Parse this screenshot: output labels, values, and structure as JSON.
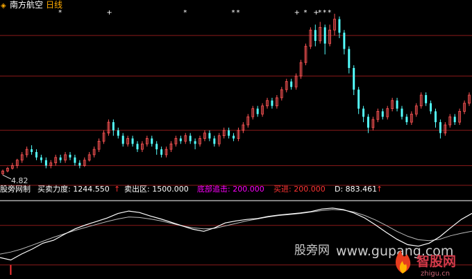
{
  "header": {
    "stock_icon": "diamond-icon",
    "stock_name": "南方航空",
    "period": "日线"
  },
  "chart_data": [
    {
      "type": "candlestick",
      "title": "南方航空 日线",
      "low_label": "4.82",
      "signal_marker": "*",
      "signal_text": "+",
      "ylim": [
        4.6,
        11.0
      ],
      "gridlines": [
        10.0,
        8.5,
        6.5,
        5.2
      ],
      "candles": [
        [
          4.9,
          5.0,
          4.85,
          5.05
        ],
        [
          5.0,
          5.1,
          4.95,
          5.15
        ],
        [
          5.1,
          5.2,
          5.05,
          5.3
        ],
        [
          5.2,
          5.4,
          5.1,
          5.45
        ],
        [
          5.4,
          5.6,
          5.3,
          5.7
        ],
        [
          5.6,
          5.8,
          5.5,
          5.9
        ],
        [
          5.8,
          5.7,
          5.6,
          5.95
        ],
        [
          5.7,
          5.5,
          5.4,
          5.8
        ],
        [
          5.5,
          5.4,
          5.3,
          5.6
        ],
        [
          5.4,
          5.2,
          5.1,
          5.5
        ],
        [
          5.2,
          5.3,
          5.1,
          5.4
        ],
        [
          5.3,
          5.5,
          5.2,
          5.6
        ],
        [
          5.5,
          5.4,
          5.3,
          5.6
        ],
        [
          5.4,
          5.6,
          5.3,
          5.7
        ],
        [
          5.6,
          5.5,
          5.4,
          5.7
        ],
        [
          5.5,
          5.3,
          5.2,
          5.6
        ],
        [
          5.3,
          5.2,
          5.1,
          5.4
        ],
        [
          5.2,
          5.4,
          5.15,
          5.5
        ],
        [
          5.4,
          5.6,
          5.35,
          5.7
        ],
        [
          5.6,
          5.8,
          5.5,
          5.9
        ],
        [
          5.8,
          6.1,
          5.7,
          6.2
        ],
        [
          6.1,
          6.4,
          6.0,
          6.5
        ],
        [
          6.4,
          6.8,
          6.3,
          6.9
        ],
        [
          6.8,
          6.5,
          6.3,
          6.9
        ],
        [
          6.5,
          6.3,
          6.2,
          6.6
        ],
        [
          6.3,
          6.0,
          5.9,
          6.4
        ],
        [
          6.0,
          6.2,
          5.9,
          6.3
        ],
        [
          6.2,
          6.0,
          5.9,
          6.3
        ],
        [
          6.0,
          5.8,
          5.7,
          6.1
        ],
        [
          5.8,
          6.0,
          5.7,
          6.1
        ],
        [
          6.0,
          6.2,
          5.9,
          6.3
        ],
        [
          6.2,
          6.0,
          5.9,
          6.3
        ],
        [
          6.0,
          5.8,
          5.6,
          6.1
        ],
        [
          5.8,
          5.6,
          5.5,
          5.9
        ],
        [
          5.6,
          5.8,
          5.5,
          5.9
        ],
        [
          5.8,
          6.0,
          5.7,
          6.1
        ],
        [
          6.0,
          6.2,
          5.9,
          6.3
        ],
        [
          6.2,
          6.1,
          6.0,
          6.3
        ],
        [
          6.1,
          6.3,
          6.0,
          6.4
        ],
        [
          6.3,
          6.1,
          6.0,
          6.4
        ],
        [
          6.1,
          6.0,
          5.8,
          6.2
        ],
        [
          6.0,
          6.2,
          5.9,
          6.3
        ],
        [
          6.2,
          6.4,
          6.1,
          6.5
        ],
        [
          6.4,
          6.2,
          6.1,
          6.5
        ],
        [
          6.2,
          6.0,
          5.9,
          6.3
        ],
        [
          6.0,
          6.3,
          5.9,
          6.4
        ],
        [
          6.3,
          6.5,
          6.2,
          6.6
        ],
        [
          6.5,
          6.3,
          6.2,
          6.6
        ],
        [
          6.3,
          6.2,
          6.1,
          6.4
        ],
        [
          6.2,
          6.5,
          6.1,
          6.6
        ],
        [
          6.5,
          6.7,
          6.4,
          6.8
        ],
        [
          6.7,
          7.0,
          6.6,
          7.1
        ],
        [
          7.0,
          7.3,
          6.9,
          7.4
        ],
        [
          7.3,
          7.1,
          7.0,
          7.4
        ],
        [
          7.1,
          7.4,
          7.0,
          7.5
        ],
        [
          7.4,
          7.6,
          7.3,
          7.7
        ],
        [
          7.6,
          7.4,
          7.3,
          7.7
        ],
        [
          7.4,
          7.7,
          7.3,
          7.8
        ],
        [
          7.7,
          8.0,
          7.6,
          8.1
        ],
        [
          8.0,
          8.3,
          7.9,
          8.4
        ],
        [
          8.3,
          8.1,
          8.0,
          8.4
        ],
        [
          8.1,
          8.5,
          8.0,
          8.6
        ],
        [
          8.5,
          9.0,
          8.4,
          9.1
        ],
        [
          9.0,
          9.6,
          8.9,
          9.7
        ],
        [
          9.6,
          10.2,
          9.5,
          10.3
        ],
        [
          10.2,
          9.8,
          9.6,
          10.4
        ],
        [
          9.8,
          10.3,
          9.7,
          10.5
        ],
        [
          10.3,
          9.7,
          9.3,
          10.4
        ],
        [
          9.7,
          10.2,
          9.6,
          10.4
        ],
        [
          10.2,
          10.6,
          10.0,
          10.8
        ],
        [
          10.6,
          10.1,
          9.9,
          10.7
        ],
        [
          10.1,
          9.5,
          9.3,
          10.2
        ],
        [
          9.5,
          8.8,
          8.6,
          9.6
        ],
        [
          8.8,
          8.0,
          7.8,
          8.9
        ],
        [
          8.0,
          7.3,
          7.1,
          8.1
        ],
        [
          7.3,
          7.0,
          6.8,
          7.4
        ],
        [
          7.0,
          6.6,
          6.4,
          7.1
        ],
        [
          6.6,
          6.9,
          6.5,
          7.0
        ],
        [
          6.9,
          7.2,
          6.8,
          7.3
        ],
        [
          7.2,
          7.0,
          6.9,
          7.3
        ],
        [
          7.0,
          7.3,
          6.9,
          7.4
        ],
        [
          7.3,
          7.6,
          7.2,
          7.7
        ],
        [
          7.6,
          7.3,
          7.2,
          7.7
        ],
        [
          7.3,
          7.0,
          6.9,
          7.4
        ],
        [
          7.0,
          6.8,
          6.7,
          7.1
        ],
        [
          6.8,
          7.1,
          6.7,
          7.2
        ],
        [
          7.1,
          7.4,
          7.0,
          7.5
        ],
        [
          7.4,
          7.8,
          7.3,
          7.9
        ],
        [
          7.8,
          7.5,
          7.4,
          7.9
        ],
        [
          7.5,
          7.2,
          7.1,
          7.6
        ],
        [
          7.2,
          6.8,
          6.6,
          7.3
        ],
        [
          6.8,
          6.4,
          6.2,
          6.9
        ],
        [
          6.4,
          6.7,
          6.3,
          6.8
        ],
        [
          6.7,
          7.0,
          6.6,
          7.1
        ],
        [
          7.0,
          6.8,
          6.7,
          7.1
        ],
        [
          6.8,
          7.2,
          6.7,
          7.3
        ],
        [
          7.2,
          7.5,
          7.1,
          7.6
        ],
        [
          7.5,
          7.8,
          7.4,
          7.9
        ]
      ]
    },
    {
      "type": "line",
      "title": "股旁网制",
      "legend": [
        {
          "label": "买卖力度: 1244.550",
          "color": "#ffffff",
          "arrow": "↑"
        },
        {
          "label": "卖出区: 1500.000",
          "color": "#ffffff"
        },
        {
          "label": "底部追击: 200.000",
          "color": "#ff00ff"
        },
        {
          "label": "买进: 200.000",
          "color": "#ff3333"
        },
        {
          "label": "D: 883.461",
          "color": "#ffffff",
          "arrow": "↑"
        }
      ],
      "ylim": [
        0,
        1600
      ],
      "gridlines": [
        1500,
        1000,
        200
      ],
      "series": [
        {
          "name": "买卖力度",
          "values": [
            350,
            300,
            420,
            520,
            640,
            700,
            820,
            930,
            1010,
            1080,
            1150,
            1240,
            1290,
            1260,
            1190,
            1130,
            1060,
            990,
            920,
            880,
            950,
            1050,
            1090,
            1120,
            1140,
            1180,
            1210,
            1230,
            1250,
            1280,
            1330,
            1350,
            1320,
            1250,
            1150,
            1010,
            860,
            720,
            610,
            580,
            640,
            770,
            950,
            1120,
            1244
          ]
        },
        {
          "name": "D",
          "values": [
            420,
            460,
            520,
            600,
            680,
            760,
            830,
            900,
            960,
            1020,
            1080,
            1130,
            1170,
            1160,
            1130,
            1090,
            1040,
            990,
            950,
            930,
            940,
            990,
            1040,
            1090,
            1130,
            1170,
            1200,
            1220,
            1240,
            1270,
            1300,
            1320,
            1310,
            1270,
            1200,
            1110,
            1000,
            880,
            780,
            710,
            690,
            720,
            790,
            840,
            883
          ]
        }
      ]
    }
  ],
  "watermark": {
    "text_cn": "股旁网",
    "url": "www.gupang.com",
    "brand_cn": "智股网",
    "brand_url": "zhigu.cn"
  }
}
